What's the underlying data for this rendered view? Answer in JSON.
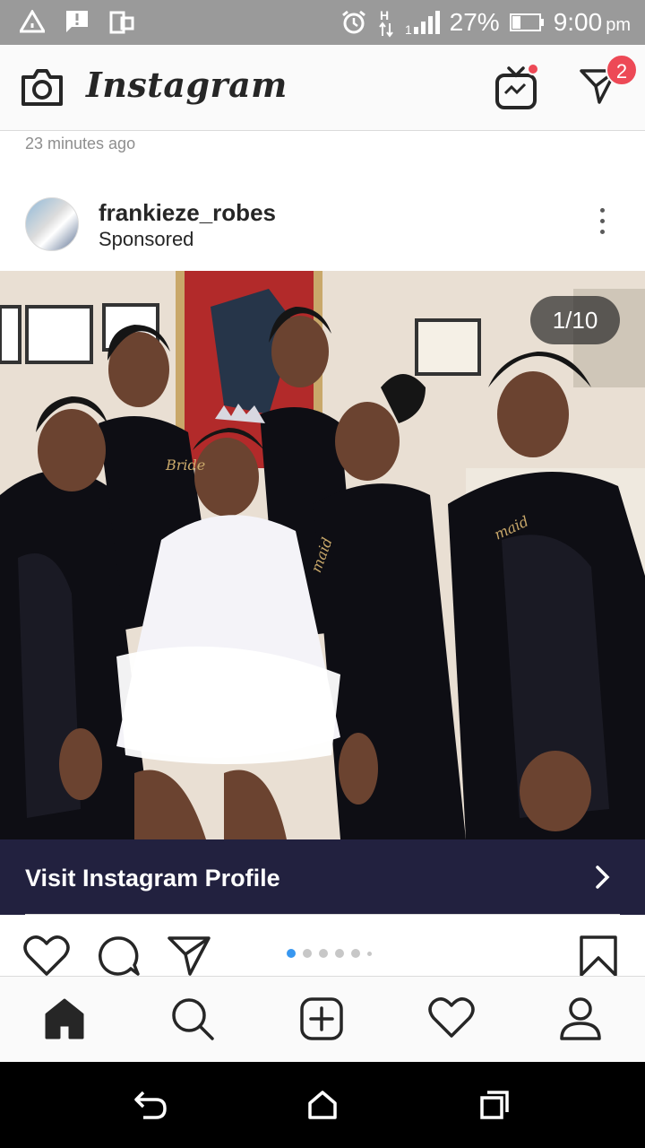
{
  "status_bar": {
    "battery": "27%",
    "time": "9:00",
    "time_suffix": "pm",
    "icons": [
      "alert-triangle-icon",
      "message-alert-icon",
      "screen-icon",
      "alarm-icon",
      "h-network-icon",
      "signal-icon",
      "battery-icon"
    ]
  },
  "header": {
    "app_title": "Instagram",
    "direct_badge": "2",
    "icons": [
      "camera-icon",
      "igtv-icon",
      "direct-message-icon"
    ]
  },
  "feed": {
    "previous_post_timestamp": "23 minutes ago"
  },
  "post": {
    "username": "frankieze_robes",
    "sponsored_label": "Sponsored",
    "carousel_counter": "1/10",
    "carousel_position": 1,
    "carousel_total": 10,
    "cta_label": "Visit Instagram Profile"
  },
  "tabs": [
    "home-icon",
    "search-icon",
    "new-post-icon",
    "activity-icon",
    "profile-icon"
  ],
  "system_nav": [
    "back-icon",
    "home-icon",
    "recents-icon"
  ],
  "colors": {
    "status_bar": "#9a9a9a",
    "cta_background": "#22213f",
    "badge": "#ed4956",
    "active_dot": "#3897f0"
  }
}
